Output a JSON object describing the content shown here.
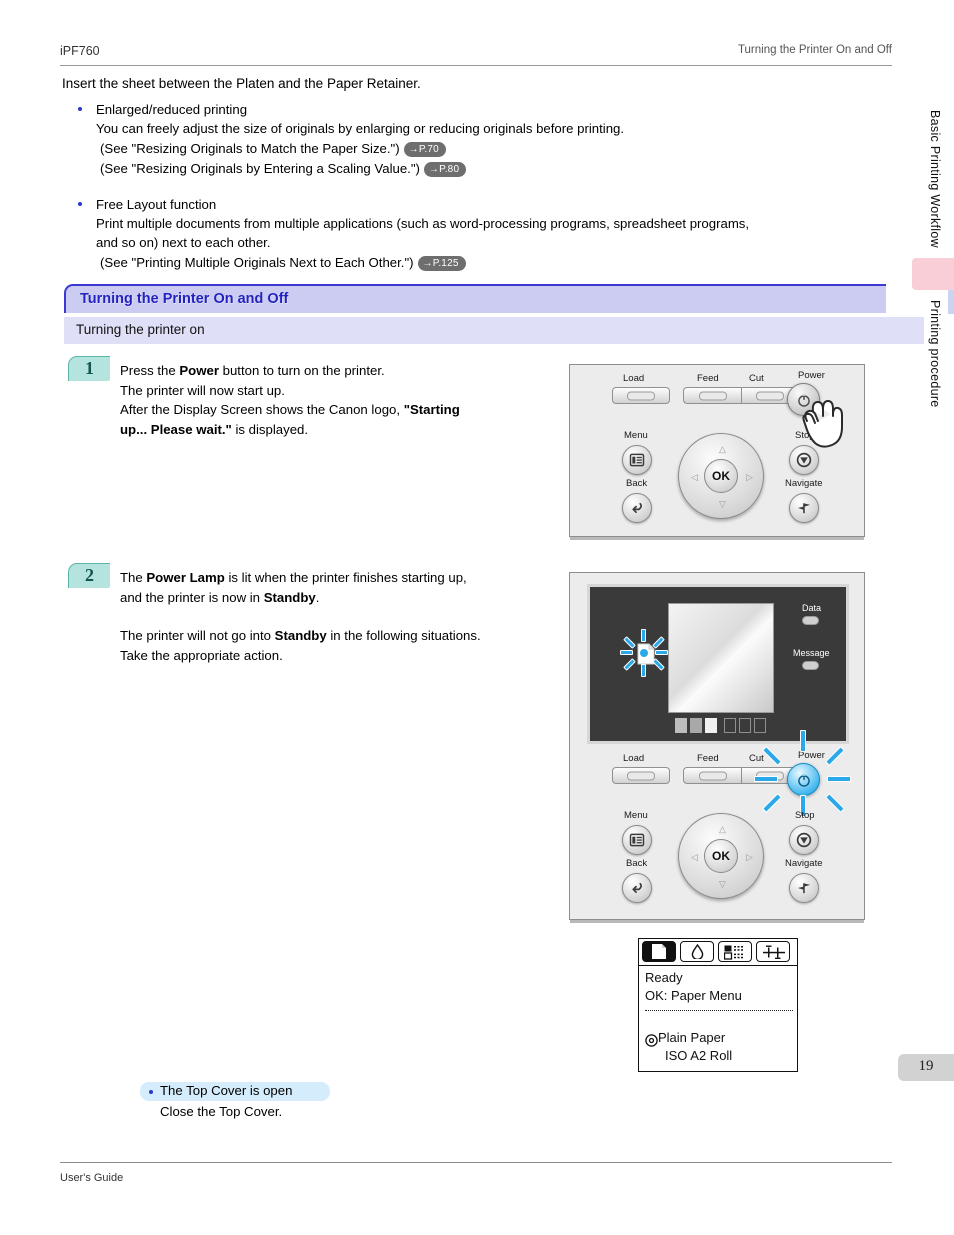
{
  "header": {
    "model": "iPF760",
    "section": "Turning the Printer On and Off"
  },
  "intro": {
    "lead": "Insert the sheet between the Platen and the Paper Retainer.",
    "bullets": [
      {
        "title": "Enlarged/reduced printing",
        "body": "You can freely adjust the size of originals by enlarging or reducing originals before printing.",
        "refs": [
          {
            "text": "(See \"Resizing Originals to Match the Paper Size.\")",
            "page": "→P.70"
          },
          {
            "text": "(See \"Resizing Originals by Entering a Scaling Value.\")",
            "page": "→P.80"
          }
        ]
      },
      {
        "title": "Free Layout function",
        "body": "Print multiple documents from multiple applications (such as word-processing programs, spreadsheet programs,",
        "body2": "and so on) next to each other.",
        "refs": [
          {
            "text": "(See \"Printing Multiple Originals Next to Each Other.\")",
            "page": "→P.125"
          }
        ]
      }
    ]
  },
  "section": {
    "heading": "Turning the Printer On and Off",
    "subheading": "Turning the printer on"
  },
  "steps": [
    {
      "num": "1",
      "lines": [
        "Press the Power button to turn on the printer.",
        "The printer will now start up.",
        "After the Display Screen shows the Canon logo, \"Starting",
        "up... Please wait.\" is displayed."
      ],
      "bold": [
        "Power",
        "Starting",
        "up... Please wait."
      ]
    },
    {
      "num": "2",
      "lines": [
        "The Power Lamp is lit when the printer finishes starting up,",
        "and the printer is now in Standby.",
        "The printer will not go into Standby in the following situations.",
        "Take the appropriate action."
      ],
      "bold": [
        "Power Lamp",
        "Standby"
      ]
    }
  ],
  "control_panel": {
    "top_buttons": [
      "Load",
      "Feed",
      "Cut",
      "Power"
    ],
    "left_buttons": [
      "Menu",
      "Back"
    ],
    "right_buttons": [
      "Stop",
      "Navigate"
    ],
    "center_button": "OK",
    "lamps": [
      "Data",
      "Message"
    ]
  },
  "lcd": {
    "tabs": [
      "paper-tab-icon",
      "ink-tab-icon",
      "media-tab-icon",
      "settings-tab-icon"
    ],
    "status": "Ready",
    "action": "OK: Paper Menu",
    "paper_type": "Plain Paper",
    "paper_size": "ISO A2 Roll"
  },
  "note": {
    "title": "The Top Cover is open",
    "action": "Close the Top Cover."
  },
  "sidebar": {
    "tab_top": "Basic Printing Workflow",
    "tab_bottom": "Printing procedure",
    "page_number": "19"
  },
  "footer": {
    "label": "User's Guide"
  },
  "colors": {
    "heading_bg": "#ccccf2",
    "heading_text": "#2222c0",
    "subheading_bg": "#dfdff7",
    "step_badge": "#b5e4de",
    "ref_badge": "#6e6e6e",
    "note_pill": "#d4ecfb",
    "lamp_glow": "#2aa8e8",
    "pink_tab": "#f9ced6"
  }
}
